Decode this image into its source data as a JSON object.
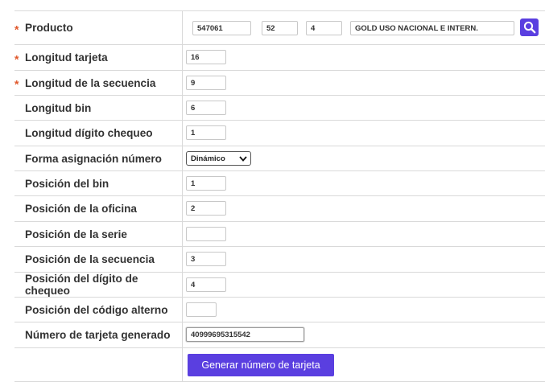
{
  "producto": {
    "label": "Producto",
    "required_mark": "*",
    "code1": "547061",
    "code2": "52",
    "code3": "4",
    "description": "GOLD USO NACIONAL E INTERN.",
    "search_icon": "search-icon"
  },
  "fields": {
    "longitud_tarjeta": {
      "label": "Longitud tarjeta",
      "required_mark": "*",
      "value": "16"
    },
    "longitud_secuencia": {
      "label": "Longitud de la secuencia",
      "required_mark": "*",
      "value": "9"
    },
    "longitud_bin": {
      "label": "Longitud bin",
      "value": "6"
    },
    "longitud_digito": {
      "label": "Longitud dígito chequeo",
      "value": "1"
    },
    "forma_asignacion": {
      "label": "Forma asignación número",
      "selected": "Dinámico"
    },
    "posicion_bin": {
      "label": "Posición del bin",
      "value": "1"
    },
    "posicion_oficina": {
      "label": "Posición de la oficina",
      "value": "2"
    },
    "posicion_serie": {
      "label": "Posición de la serie",
      "value": ""
    },
    "posicion_secuencia": {
      "label": "Posición de la secuencia",
      "value": "3"
    },
    "posicion_digito": {
      "label": "Posición del dígito de chequeo",
      "value": "4"
    },
    "posicion_alterno": {
      "label": "Posición del código alterno",
      "value": ""
    },
    "numero_generado": {
      "label": "Número de tarjeta generado",
      "value": "40999695315542"
    }
  },
  "actions": {
    "generate_label": "Generar número de tarjeta"
  },
  "colors": {
    "accent": "#5a3fe0",
    "required": "#e0572a",
    "border": "#d9d9d9"
  }
}
